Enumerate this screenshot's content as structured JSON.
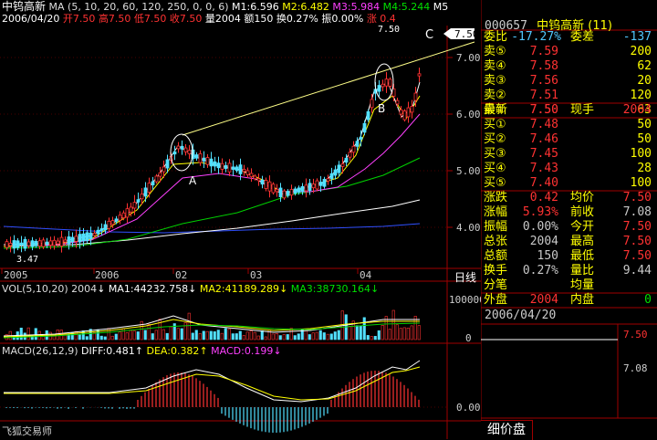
{
  "header": {
    "title": "中钨高新",
    "ma_params": "MA (5, 10, 20, 60, 120, 250, 0, 0, 6)",
    "m1": "M1:6.596",
    "m2": "M2:6.482",
    "m3": "M3:5.984",
    "m4": "M4:5.244",
    "m5": "M5",
    "date": "2006/04/20",
    "open": "开7.50",
    "high": "高7.50",
    "low": "低7.50",
    "close": "收7.50",
    "vol": "量2004",
    "amount": "额150",
    "turnover": "换0.27%",
    "amplitude": "振0.00%",
    "change": "涨 0.4"
  },
  "annotations": {
    "a": "A",
    "b": "B",
    "c": "C",
    "price_tag": "7.50",
    "price_tag_left": "7.50",
    "low_label": "3.47"
  },
  "price_axis": [
    "7.00",
    "6.00",
    "5.00",
    "4.00"
  ],
  "date_axis": [
    "2005",
    "2006",
    "02",
    "03",
    "04"
  ],
  "period_label": "日线",
  "vol_panel": {
    "label": "VOL(5,10,20) 2004",
    "ma1": "MA1:44232.758",
    "ma2": "MA2:41189.289",
    "ma3": "MA3:38730.164",
    "axis_top": "100000",
    "axis_zero": "0"
  },
  "macd_panel": {
    "label": "MACD(26,12,9)",
    "diff": "DIFF:0.481",
    "dea": "DEA:0.382",
    "macd": "MACD:0.199",
    "axis_zero": "0.00"
  },
  "footer_label": "飞狐交易师",
  "side": {
    "code": "000657",
    "name": "中钨高新",
    "count": "(11)",
    "weibi_label": "委比",
    "weibi_value": "-17.27%",
    "weicha_label": "委差",
    "weicha_value": "-137",
    "sells": [
      {
        "label": "卖⑤",
        "price": "7.59",
        "vol": "200"
      },
      {
        "label": "卖④",
        "price": "7.58",
        "vol": "62"
      },
      {
        "label": "卖③",
        "price": "7.56",
        "vol": "20"
      },
      {
        "label": "卖②",
        "price": "7.51",
        "vol": "120"
      },
      {
        "label": "卖①",
        "price": "7.50",
        "vol": "63"
      }
    ],
    "latest_label": "最新",
    "latest_value": "7.50",
    "current_label": "现手",
    "current_value": "2004",
    "buys": [
      {
        "label": "买①",
        "price": "7.48",
        "vol": "50"
      },
      {
        "label": "买②",
        "price": "7.46",
        "vol": "50"
      },
      {
        "label": "买③",
        "price": "7.45",
        "vol": "100"
      },
      {
        "label": "买④",
        "price": "7.43",
        "vol": "28"
      },
      {
        "label": "买⑤",
        "price": "7.40",
        "vol": "100"
      }
    ],
    "stats": [
      {
        "l": "涨跌",
        "v": "0.42",
        "m": "均价",
        "r": "7.50"
      },
      {
        "l": "涨幅",
        "v": "5.93%",
        "m": "前收",
        "r": "7.08"
      },
      {
        "l": "振幅",
        "v": "0.00%",
        "m": "今开",
        "r": "7.50"
      },
      {
        "l": "总张",
        "v": "2004",
        "m": "最高",
        "r": "7.50"
      },
      {
        "l": "总额",
        "v": "150",
        "m": "最低",
        "r": "7.50"
      },
      {
        "l": "换手",
        "v": "0.27%",
        "m": "量比",
        "r": "9.44"
      },
      {
        "l": "分笔",
        "v": "",
        "m": "均量",
        "r": ""
      }
    ],
    "outer_label": "外盘",
    "outer_value": "2004",
    "inner_label": "内盘",
    "inner_value": "0",
    "tick_date": "2006/04/20",
    "tick_price_top": "7.50",
    "tick_price_mid": "7.08",
    "detail_tab": "细价盘"
  }
}
